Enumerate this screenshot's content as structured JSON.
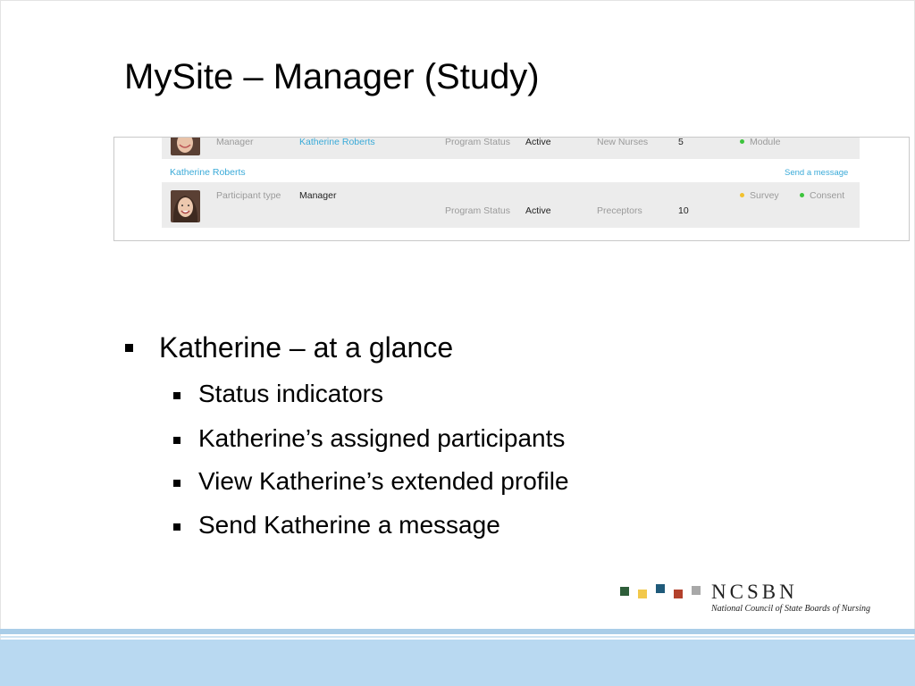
{
  "slide": {
    "title": "MySite – Manager (Study)"
  },
  "screenshot": {
    "row1": {
      "participant_type_label": "Manager",
      "manager_link": "Katherine Roberts",
      "program_status_label": "Program Status",
      "program_status_value": "Active",
      "count_label": "New Nurses",
      "count_value": "5",
      "indicator_module": "Module",
      "indicator_module_color": "#3cc43c"
    },
    "profile_link": "Katherine Roberts",
    "send_message_link": "Send a message",
    "row2": {
      "participant_type_label": "Participant type",
      "participant_type_value": "Manager",
      "program_status_label": "Program Status",
      "program_status_value": "Active",
      "count_label": "Preceptors",
      "count_value": "10",
      "indicator_survey": "Survey",
      "indicator_survey_color": "#f2c12e",
      "indicator_consent": "Consent",
      "indicator_consent_color": "#3cc43c"
    }
  },
  "bullets": {
    "main": "Katherine – at a glance",
    "sub": [
      "Status indicators",
      "Katherine’s assigned participants",
      "View Katherine’s extended profile",
      "Send Katherine a message"
    ]
  },
  "logo": {
    "name": "NCSBN",
    "subtitle": "National Council of State Boards of Nursing",
    "square_colors": [
      "#2e5e3a",
      "#f2c84b",
      "#1f5a7a",
      "#b3412b",
      "#a8a8a8"
    ]
  },
  "colors": {
    "link": "#3aaad8",
    "footer": "#b9d9f1"
  }
}
